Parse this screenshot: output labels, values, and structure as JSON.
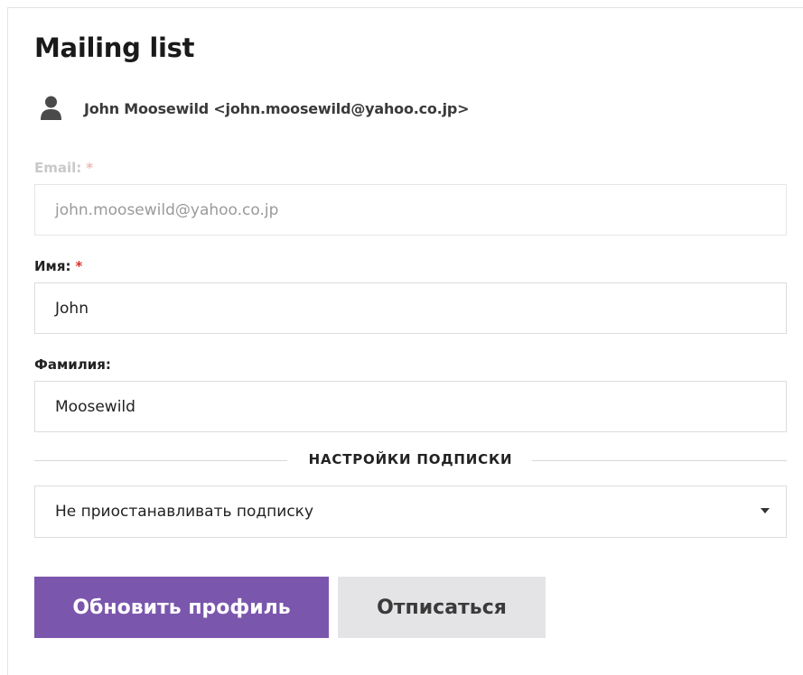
{
  "title": "Mailing list",
  "user": {
    "icon": "user-icon",
    "display": "John Moosewild <john.moosewild@yahoo.co.jp>"
  },
  "fields": {
    "email": {
      "label": "Email:",
      "required_mark": "*",
      "value": "john.moosewild@yahoo.co.jp",
      "disabled": true
    },
    "first_name": {
      "label": "Имя:",
      "required_mark": "*",
      "value": "John"
    },
    "last_name": {
      "label": "Фамилия:",
      "value": "Moosewild"
    }
  },
  "subscription": {
    "section_label": "НАСТРОЙКИ ПОДПИСКИ",
    "selected": "Не приостанавливать подписку"
  },
  "buttons": {
    "update": "Обновить профиль",
    "unsubscribe": "Отписаться"
  },
  "colors": {
    "primary": "#7b56ad",
    "secondary": "#e4e4e6",
    "required": "#d9312b"
  }
}
